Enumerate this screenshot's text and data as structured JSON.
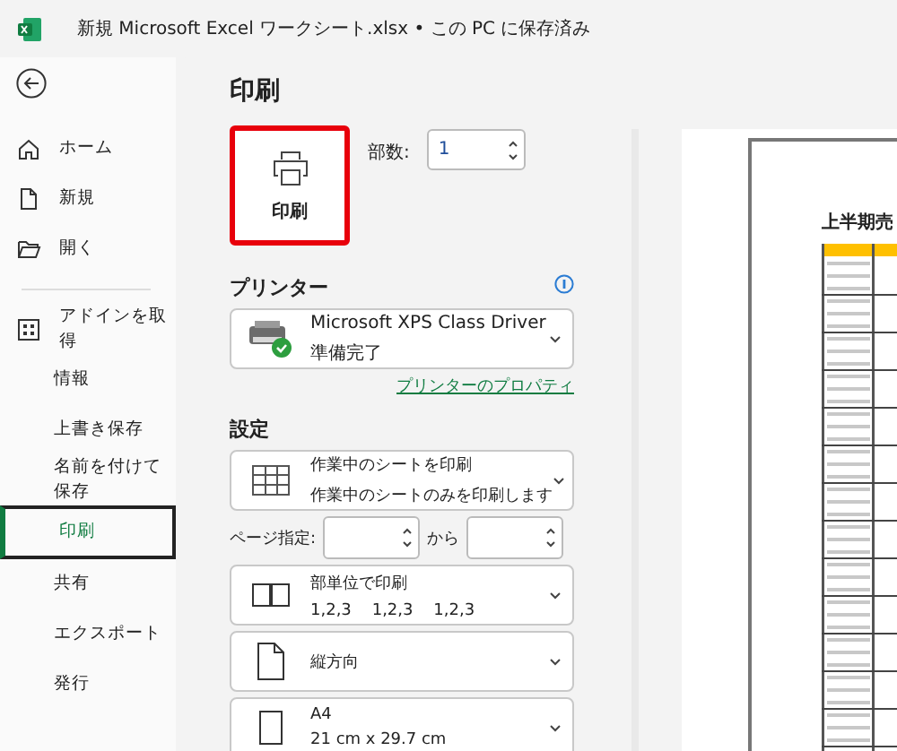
{
  "window": {
    "title": "新規 Microsoft Excel ワークシート.xlsx • この PC に保存済み"
  },
  "sidebar": {
    "top_items": [
      {
        "label": "ホーム",
        "selected": false
      },
      {
        "label": "新規",
        "selected": false
      },
      {
        "label": "開く",
        "selected": false
      }
    ],
    "bottom_items": [
      {
        "label": "アドインを取得",
        "selected": false
      },
      {
        "label": "情報",
        "selected": false
      },
      {
        "label": "上書き保存",
        "selected": false
      },
      {
        "label": "名前を付けて保存",
        "selected": false
      },
      {
        "label": "印刷",
        "selected": true
      },
      {
        "label": "共有",
        "selected": false
      },
      {
        "label": "エクスポート",
        "selected": false
      },
      {
        "label": "発行",
        "selected": false
      }
    ]
  },
  "print": {
    "heading": "印刷",
    "button": "印刷",
    "copies_label": "部数:",
    "copies": "1"
  },
  "printer": {
    "heading": "プリンター",
    "name": "Microsoft XPS Class Driver",
    "status": "準備完了",
    "ready": true,
    "properties_link": "プリンターのプロパティ"
  },
  "settings": {
    "heading": "設定",
    "options": [
      {
        "title": "作業中のシートを印刷",
        "detail": "作業中のシートのみを印刷します"
      },
      {
        "title": "部単位で印刷",
        "detail": "1,2,3    1,2,3    1,2,3"
      },
      {
        "title": "縦方向"
      },
      {
        "title": "A4",
        "detail": "21 cm x 29.7 cm"
      }
    ],
    "page_range": {
      "label": "ページ指定:",
      "to": "から"
    }
  },
  "preview": {
    "title": "上半期売"
  }
}
